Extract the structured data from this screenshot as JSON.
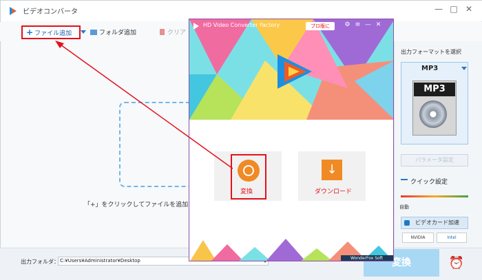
{
  "window": {
    "title": "ビデオコンバータ",
    "controls": [
      "—",
      "□",
      "✕"
    ]
  },
  "toolbar": {
    "add_file_label": "ファイル追加",
    "add_folder_label": "フォルダ追加",
    "clear_label": "クリア"
  },
  "main": {
    "drop_hint": "「+」をクリックしてファイルを追加する"
  },
  "right_panel": {
    "format_label": "出力フォーマットを選択",
    "format_name": "MP3",
    "format_icon_text": "MP3",
    "param_button": "パラメータ設定",
    "quick_label": "クイック設定",
    "auto_label": "自動",
    "gpu_label": "ビデオカード加速",
    "nvidia_label": "NVIDIA",
    "intel_label": "Intel"
  },
  "bottom": {
    "output_label": "出力フォルダ：",
    "output_path": "C:¥Users¥Administrator¥Desktop",
    "convert_label": "変換"
  },
  "overlay": {
    "title": "HD Video Converter Factory",
    "upgrade_label": "プロ版に",
    "controls": [
      "⚙",
      "≡",
      "—",
      "✕"
    ],
    "convert_label": "変換",
    "download_label": "ダウンロード",
    "brand_label": "WonderFox Soft"
  },
  "colors": {
    "accent": "#1d78c8",
    "highlight": "#e3111b",
    "orange": "#f08a24"
  }
}
